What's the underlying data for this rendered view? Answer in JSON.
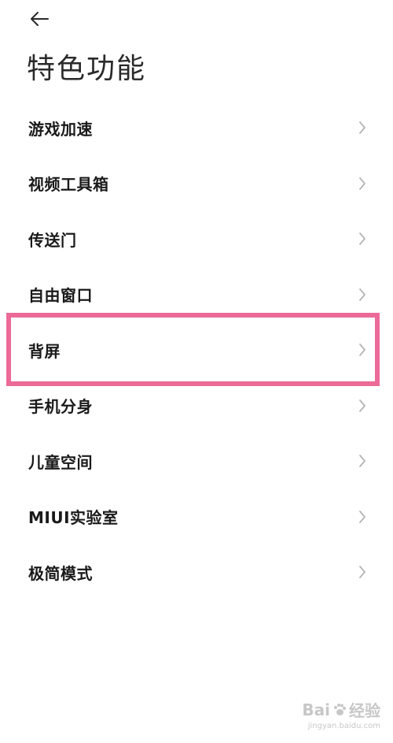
{
  "header": {
    "back_icon": "arrow-left-icon",
    "title": "特色功能"
  },
  "menu": {
    "items": [
      {
        "label": "游戏加速"
      },
      {
        "label": "视频工具箱"
      },
      {
        "label": "传送门"
      },
      {
        "label": "自由窗口"
      },
      {
        "label": "背屏"
      },
      {
        "label": "手机分身"
      },
      {
        "label": "儿童空间"
      },
      {
        "label": "MIUI实验室"
      },
      {
        "label": "极简模式"
      }
    ],
    "chevron_icon": "chevron-right-icon",
    "highlighted_item": "背屏"
  },
  "colors": {
    "highlight": "#ec6a98",
    "text": "#1a1a1a",
    "chevron": "#b5b5b5",
    "background": "#ffffff"
  },
  "watermark": {
    "brand": "Bai",
    "brand_tail": "经验",
    "url": "jingyan.baidu.com"
  }
}
